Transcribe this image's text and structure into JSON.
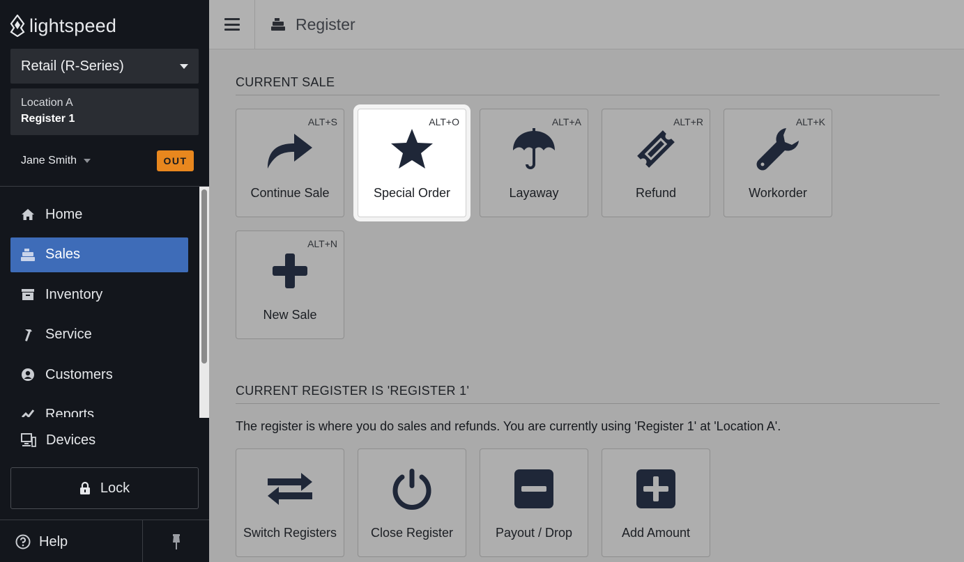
{
  "sidebar": {
    "logo_text": "lightspeed",
    "product": "Retail (R-Series)",
    "location": "Location A",
    "register": "Register 1",
    "user": "Jane Smith",
    "status_badge": "OUT",
    "nav": [
      {
        "label": "Home",
        "icon": "home-icon"
      },
      {
        "label": "Sales",
        "icon": "register-icon",
        "active": true
      },
      {
        "label": "Inventory",
        "icon": "inventory-icon"
      },
      {
        "label": "Service",
        "icon": "hammer-icon"
      },
      {
        "label": "Customers",
        "icon": "user-circle-icon"
      },
      {
        "label": "Reports",
        "icon": "chart-icon"
      }
    ],
    "devices": "Devices",
    "lock": "Lock",
    "help": "Help"
  },
  "header": {
    "title": "Register"
  },
  "current_sale": {
    "title": "CURRENT SALE",
    "tiles": [
      {
        "label": "Continue Sale",
        "shortcut": "ALT+S",
        "icon": "share-arrow-icon"
      },
      {
        "label": "Special Order",
        "shortcut": "ALT+O",
        "icon": "star-icon",
        "highlighted": true
      },
      {
        "label": "Layaway",
        "shortcut": "ALT+A",
        "icon": "umbrella-icon"
      },
      {
        "label": "Refund",
        "shortcut": "ALT+R",
        "icon": "ticket-icon"
      },
      {
        "label": "Workorder",
        "shortcut": "ALT+K",
        "icon": "wrench-icon"
      },
      {
        "label": "New Sale",
        "shortcut": "ALT+N",
        "icon": "plus-icon"
      }
    ]
  },
  "current_register": {
    "title": "CURRENT REGISTER IS 'REGISTER 1'",
    "description": "The register is where you do sales and refunds. You are currently using 'Register 1'  at 'Location A'.",
    "tiles": [
      {
        "label": "Switch Registers",
        "icon": "exchange-icon"
      },
      {
        "label": "Close Register",
        "icon": "power-icon"
      },
      {
        "label": "Payout / Drop",
        "icon": "minus-square-icon"
      },
      {
        "label": "Add Amount",
        "icon": "plus-square-icon"
      }
    ]
  },
  "colors": {
    "sidebar_bg": "#13161c",
    "active_nav": "#3e6cb8",
    "badge": "#e8871e",
    "icon": "#1f2738"
  }
}
